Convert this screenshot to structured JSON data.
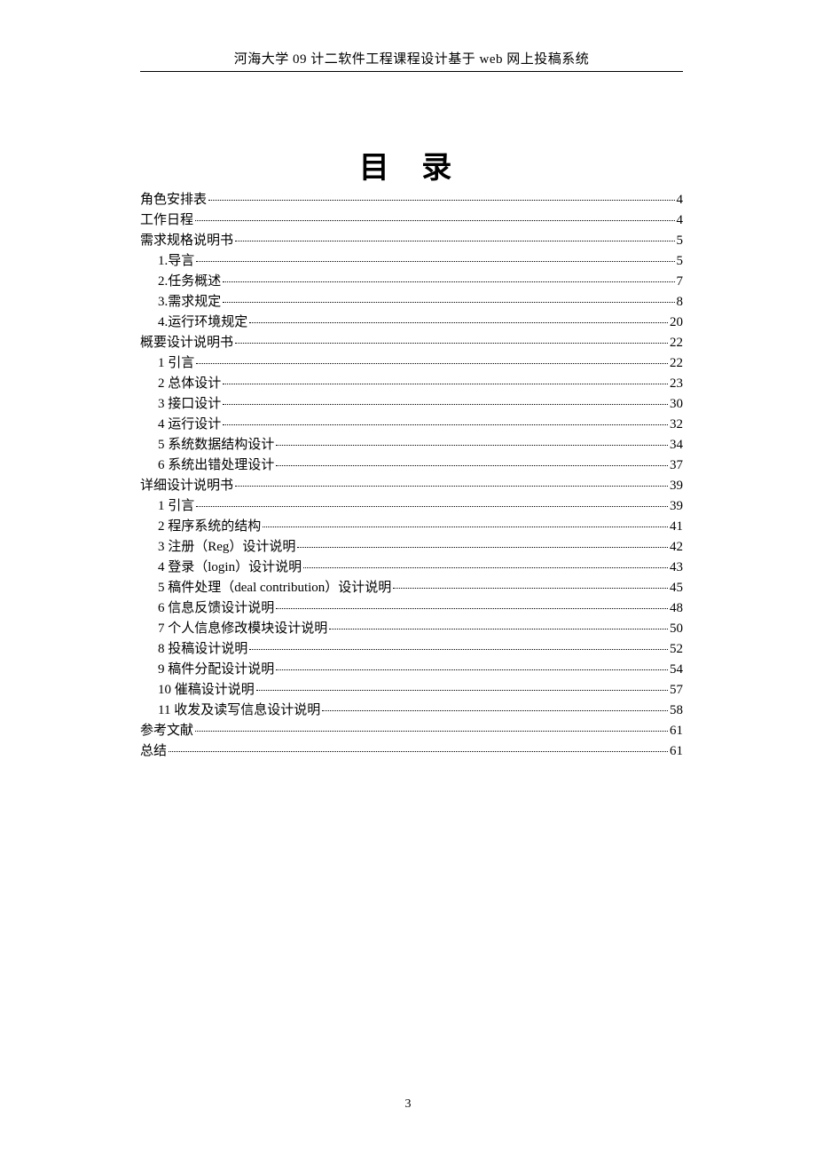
{
  "running_head": "河海大学 09 计二软件工程课程设计基于 web 网上投稿系统",
  "title": "目  录",
  "toc": [
    {
      "level": 0,
      "label": "角色安排表",
      "page": "4"
    },
    {
      "level": 0,
      "label": "工作日程",
      "page": "4"
    },
    {
      "level": 0,
      "label": "需求规格说明书",
      "page": "5"
    },
    {
      "level": 1,
      "label": "1.导言",
      "page": "5"
    },
    {
      "level": 1,
      "label": "2.任务概述",
      "page": "7"
    },
    {
      "level": 1,
      "label": "3.需求规定",
      "page": "8"
    },
    {
      "level": 1,
      "label": "4.运行环境规定",
      "page": "20"
    },
    {
      "level": 0,
      "label": "概要设计说明书",
      "page": "22"
    },
    {
      "level": 1,
      "label": "1 引言",
      "page": "22"
    },
    {
      "level": 1,
      "label": "2 总体设计",
      "page": "23"
    },
    {
      "level": 1,
      "label": "3 接口设计",
      "page": "30"
    },
    {
      "level": 1,
      "label": "4 运行设计",
      "page": "32"
    },
    {
      "level": 1,
      "label": "5 系统数据结构设计",
      "page": "34"
    },
    {
      "level": 1,
      "label": "6 系统出错处理设计",
      "page": "37"
    },
    {
      "level": 0,
      "label": "详细设计说明书",
      "page": "39"
    },
    {
      "level": 1,
      "label": "1 引言",
      "page": "39"
    },
    {
      "level": 1,
      "label": "2 程序系统的结构",
      "page": "41"
    },
    {
      "level": 1,
      "label": "3 注册（Reg）设计说明",
      "page": "42"
    },
    {
      "level": 1,
      "label": "4  登录（login）设计说明",
      "page": "43"
    },
    {
      "level": 1,
      "label": "5 稿件处理（deal contribution）设计说明",
      "page": "45"
    },
    {
      "level": 1,
      "label": "6 信息反馈设计说明",
      "page": "48"
    },
    {
      "level": 1,
      "label": "7 个人信息修改模块设计说明",
      "page": "50"
    },
    {
      "level": 1,
      "label": "8 投稿设计说明",
      "page": "52"
    },
    {
      "level": 1,
      "label": "9 稿件分配设计说明",
      "page": "54"
    },
    {
      "level": 1,
      "label": "10 催稿设计说明",
      "page": "57"
    },
    {
      "level": 1,
      "label": "11 收发及读写信息设计说明",
      "page": "58"
    },
    {
      "level": 0,
      "label": "参考文献",
      "page": "61"
    },
    {
      "level": 0,
      "label": "总结",
      "page": "61"
    }
  ],
  "page_number": "3"
}
